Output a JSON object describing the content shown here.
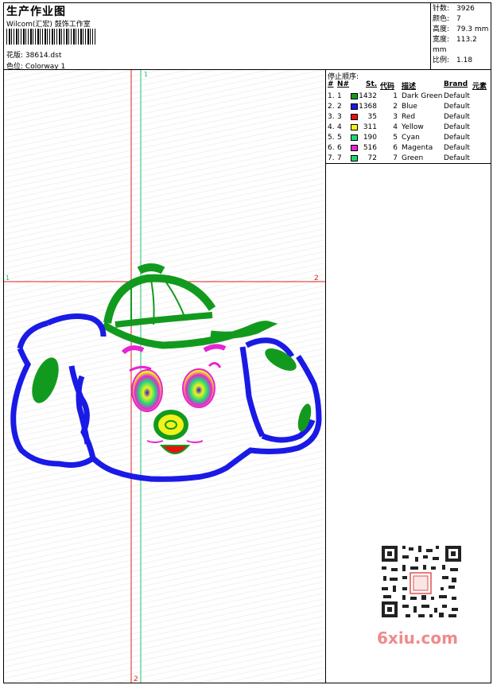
{
  "header": {
    "title": "生产作业图",
    "subtitle": "Wilcom(汇宏) 鼓饰工作室",
    "file_label": "花版:",
    "file_value": "38614.dst",
    "colorway_label": "色位:",
    "colorway_value": "Colorway 1"
  },
  "stats": {
    "stitches_label": "针数:",
    "stitches_value": "3926",
    "colors_label": "颜色:",
    "colors_value": "7",
    "height_label": "高度:",
    "height_value": "79.3 mm",
    "width_label": "宽度:",
    "width_value": "113.2 mm",
    "scale_label": "比例:",
    "scale_value": "1.18"
  },
  "design": {
    "markers": {
      "v_green_top": "1",
      "h_red_left": "1",
      "h_red_right": "2",
      "v_red_bottom": "2"
    }
  },
  "stop_sequence": {
    "title": "停止顺序:",
    "headers": [
      "#",
      "N#",
      "St.",
      "代码",
      "描述",
      "Brand",
      "元素"
    ],
    "rows": [
      {
        "num": "1.",
        "n": "1",
        "color": "#129a1e",
        "st": "1432",
        "code": "1",
        "desc": "Dark Green",
        "brand": "Default"
      },
      {
        "num": "2.",
        "n": "2",
        "color": "#1a1ae6",
        "st": "1368",
        "code": "2",
        "desc": "Blue",
        "brand": "Default"
      },
      {
        "num": "3.",
        "n": "3",
        "color": "#e81010",
        "st": "35",
        "code": "3",
        "desc": "Red",
        "brand": "Default"
      },
      {
        "num": "4.",
        "n": "4",
        "color": "#f2f21a",
        "st": "311",
        "code": "4",
        "desc": "Yellow",
        "brand": "Default"
      },
      {
        "num": "5.",
        "n": "5",
        "color": "#22d67a",
        "st": "190",
        "code": "5",
        "desc": "Cyan",
        "brand": "Default"
      },
      {
        "num": "6.",
        "n": "6",
        "color": "#e626d2",
        "st": "516",
        "code": "6",
        "desc": "Magenta",
        "brand": "Default"
      },
      {
        "num": "7.",
        "n": "7",
        "color": "#1cd66e",
        "st": "72",
        "code": "7",
        "desc": "Green",
        "brand": "Default"
      }
    ]
  },
  "watermark": "6xiu.com"
}
